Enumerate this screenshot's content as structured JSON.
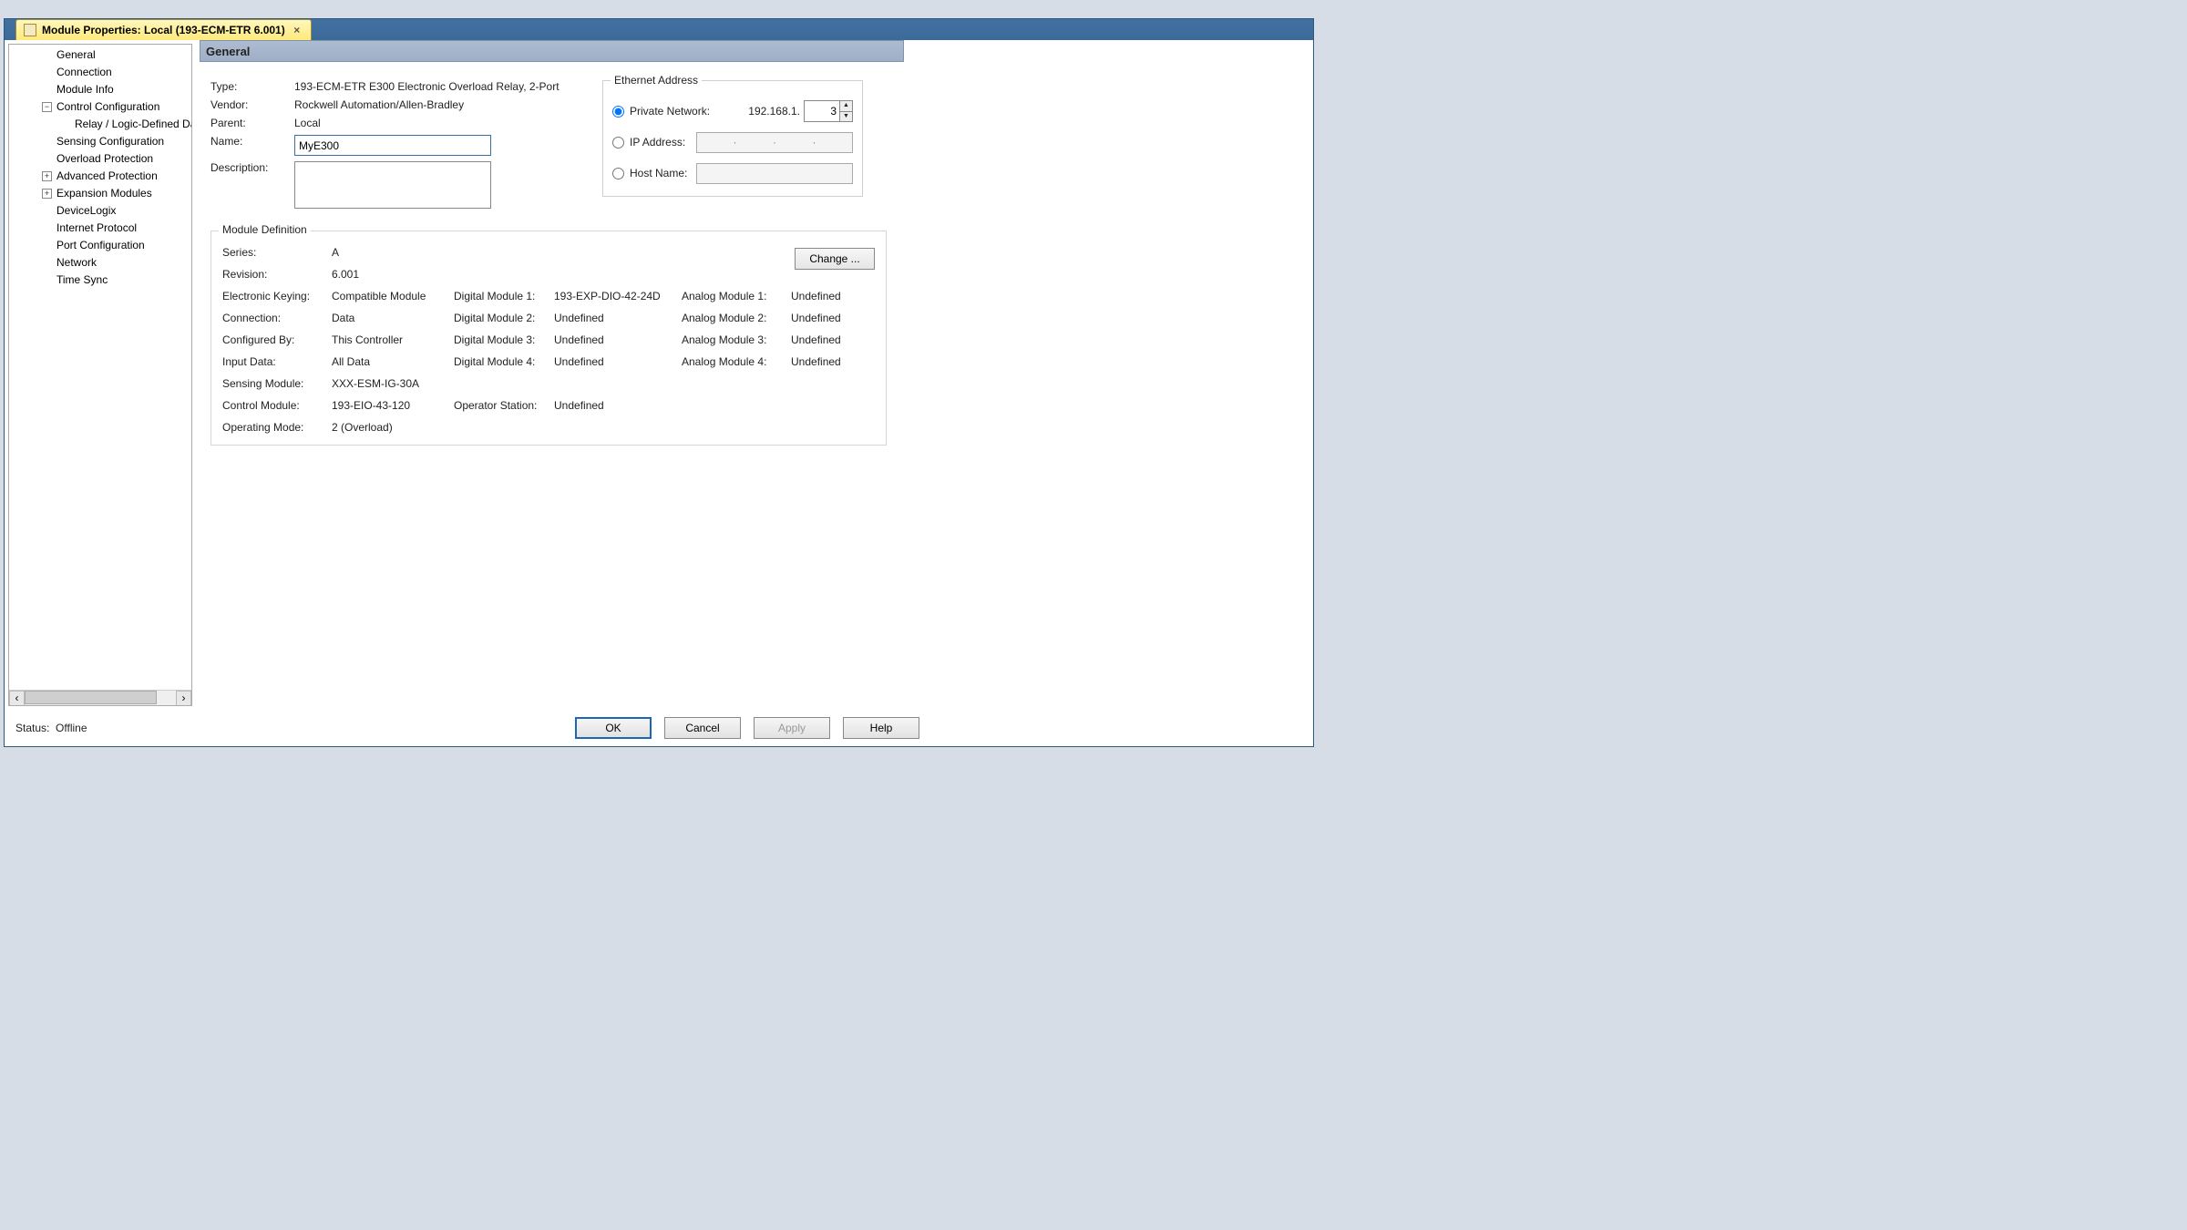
{
  "tab": {
    "title": "Module Properties: Local (193-ECM-ETR 6.001)"
  },
  "tree": {
    "items": [
      {
        "label": "General",
        "level": 1,
        "expander": null,
        "selected": true
      },
      {
        "label": "Connection",
        "level": 1,
        "expander": null
      },
      {
        "label": "Module Info",
        "level": 1,
        "expander": null
      },
      {
        "label": "Control Configuration",
        "level": 1,
        "expander": "minus"
      },
      {
        "label": "Relay / Logic-Defined Data",
        "level": 2,
        "expander": null
      },
      {
        "label": "Sensing Configuration",
        "level": 1,
        "expander": null
      },
      {
        "label": "Overload Protection",
        "level": 1,
        "expander": null
      },
      {
        "label": "Advanced Protection",
        "level": 1,
        "expander": "plus"
      },
      {
        "label": "Expansion Modules",
        "level": 1,
        "expander": "plus"
      },
      {
        "label": "DeviceLogix",
        "level": 1,
        "expander": null
      },
      {
        "label": "Internet Protocol",
        "level": 1,
        "expander": null
      },
      {
        "label": "Port Configuration",
        "level": 1,
        "expander": null
      },
      {
        "label": "Network",
        "level": 1,
        "expander": null
      },
      {
        "label": "Time Sync",
        "level": 1,
        "expander": null
      }
    ]
  },
  "header": {
    "title": "General"
  },
  "general": {
    "type_label": "Type:",
    "type_value": "193-ECM-ETR E300 Electronic Overload Relay, 2-Port",
    "vendor_label": "Vendor:",
    "vendor_value": "Rockwell Automation/Allen-Bradley",
    "parent_label": "Parent:",
    "parent_value": "Local",
    "name_label": "Name:",
    "name_value": "MyE300",
    "description_label": "Description:",
    "description_value": ""
  },
  "ethernet": {
    "legend": "Ethernet Address",
    "private_label": "Private Network:",
    "private_prefix": "192.168.1.",
    "private_value": "3",
    "ip_label": "IP Address:",
    "host_label": "Host Name:",
    "selected": "private"
  },
  "moddef": {
    "legend": "Module Definition",
    "change_label": "Change ...",
    "rows": {
      "series_l": "Series:",
      "series_v": "A",
      "rev_l": "Revision:",
      "rev_v": "6.001",
      "ek_l": "Electronic Keying:",
      "ek_v": "Compatible Module",
      "conn_l": "Connection:",
      "conn_v": "Data",
      "cfg_l": "Configured By:",
      "cfg_v": "This Controller",
      "inp_l": "Input Data:",
      "inp_v": "All Data",
      "sens_l": "Sensing Module:",
      "sens_v": "XXX-ESM-IG-30A",
      "ctrl_l": "Control Module:",
      "ctrl_v": "193-EIO-43-120",
      "op_l": "Operating Mode:",
      "op_v": "2 (Overload)",
      "dm1_l": "Digital Module 1:",
      "dm1_v": "193-EXP-DIO-42-24D",
      "dm2_l": "Digital Module 2:",
      "dm2_v": "Undefined",
      "dm3_l": "Digital Module 3:",
      "dm3_v": "Undefined",
      "dm4_l": "Digital Module 4:",
      "dm4_v": "Undefined",
      "os_l": "Operator Station:",
      "os_v": "Undefined",
      "am1_l": "Analog Module 1:",
      "am1_v": "Undefined",
      "am2_l": "Analog Module 2:",
      "am2_v": "Undefined",
      "am3_l": "Analog Module 3:",
      "am3_v": "Undefined",
      "am4_l": "Analog Module 4:",
      "am4_v": "Undefined"
    }
  },
  "footer": {
    "status_label": "Status:",
    "status_value": "Offline",
    "ok": "OK",
    "cancel": "Cancel",
    "apply": "Apply",
    "help": "Help"
  }
}
